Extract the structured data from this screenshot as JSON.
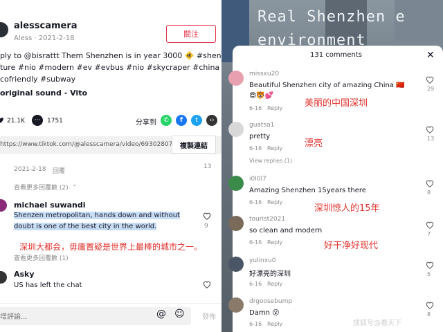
{
  "left": {
    "username": "alesscamera",
    "subline": "Aless · 2021-2-18",
    "follow_label": "關注",
    "caption_line1": "ply to @bisrattt Them Shenzhen is in year 3000 🚸 #shenzhen",
    "caption_line2": "ture #nio #modern #ev #evbus #nio #skycraper #china",
    "caption_line3": "cofriendly #subway",
    "sound": "original sound - Vito",
    "likes": "21.1K",
    "comments_count": "1751",
    "share_label": "分享到",
    "link_url": "https://www.tiktok.com/@alesscamera/video/69302807997...",
    "copy_label": "複製連結",
    "c0_date": "2021-2-18",
    "c0_reply": "回覆",
    "c0_likes": "13",
    "c0_more": "查看更多回覆數 (2)",
    "c1_user": "michael suwandi",
    "c1_line1": "Shenzen metropolitan, hands down and without",
    "c1_line2": "doubt is one of the best city in the world.",
    "c1_likes": "9",
    "c1_cn": "深圳大都会，毋庸置疑是世界上最棒的城市之一。",
    "c1_more": "查看更多回覆數 (1)",
    "c2_user": "Asky",
    "c2_text": "US has left the chat",
    "input_placeholder": "增評論...",
    "post_label": "發佈"
  },
  "right": {
    "bg_text1": "Real  Shenzhen e",
    "bg_text2": "environment",
    "header": "131 comments",
    "comments": [
      {
        "user": "missxu20",
        "text": "Beautiful Shenzhen city of amazing China 🇨🇳",
        "emoji": "😍🐯💕",
        "date": "6-16",
        "reply": "Reply",
        "likes": "29",
        "cn": "美丽的中国深圳"
      },
      {
        "user": "guatsa1",
        "text": "pretty",
        "date": "6-16",
        "reply": "Reply",
        "likes": "13",
        "cn": "漂亮",
        "view_replies": "View replies (1)"
      },
      {
        "user": "i0l0l7",
        "text": "Amazing Shenzhen 15years there",
        "date": "6-16",
        "reply": "Reply",
        "likes": "8",
        "cn": "深圳惊人的15年"
      },
      {
        "user": "tourist2021",
        "text": "so clean and modern",
        "date": "6-16",
        "reply": "Reply",
        "likes": "7",
        "cn": "好干净好现代"
      },
      {
        "user": "yulinxu0",
        "text": "好漂亮的深圳",
        "date": "6-16",
        "reply": "Reply",
        "likes": "5"
      },
      {
        "user": "drgoosebump",
        "text": "Damn 😮",
        "date": "6-16",
        "reply": "Reply",
        "likes": "8"
      }
    ],
    "watermark": "搜狐号@看天下"
  }
}
